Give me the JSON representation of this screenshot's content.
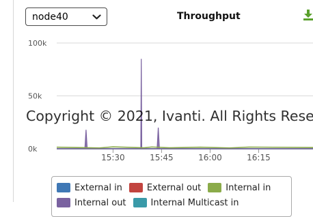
{
  "node_select": {
    "value": "node40"
  },
  "chart_title": "Throughput",
  "watermark": "Copyright © 2021, Ivanti. All Rights Rese",
  "chart_data": {
    "type": "line",
    "title": "Throughput",
    "xlabel": "",
    "ylabel": "",
    "ylim": [
      0,
      100000
    ],
    "y_ticks": [
      {
        "value": 0,
        "label": "0k"
      },
      {
        "value": 50000,
        "label": "50k"
      },
      {
        "value": 100000,
        "label": "100k"
      }
    ],
    "x_ticks": [
      {
        "value": 15.5,
        "label": "15:30"
      },
      {
        "value": 15.75,
        "label": "15:45"
      },
      {
        "value": 16.0,
        "label": "16:00"
      },
      {
        "value": 16.25,
        "label": "16:15"
      }
    ],
    "xlim": [
      15.21,
      16.53
    ],
    "grid": true,
    "legend_placement": "bottom",
    "series": [
      {
        "name": "External in",
        "color": "#3f78b5",
        "x": [
          15.21,
          16.53
        ],
        "values": [
          0,
          0
        ]
      },
      {
        "name": "External out",
        "color": "#c2443f",
        "x": [
          15.21,
          16.53
        ],
        "values": [
          0,
          0
        ]
      },
      {
        "name": "Internal in",
        "color": "#8bab4a",
        "x": [
          15.21,
          15.43,
          15.5,
          15.66,
          15.7,
          15.79,
          15.95,
          16.1,
          16.2,
          16.53
        ],
        "values": [
          1500,
          800,
          1800,
          900,
          1700,
          900,
          1500,
          800,
          1600,
          1200
        ]
      },
      {
        "name": "Internal out",
        "color": "#7a62a0",
        "x": [
          15.21,
          15.355,
          15.361,
          15.367,
          15.5,
          15.6,
          15.643,
          15.6455,
          15.648,
          15.66,
          15.727,
          15.733,
          15.739,
          15.9,
          16.1,
          16.53
        ],
        "values": [
          0,
          0,
          18000,
          0,
          0,
          0,
          0,
          85000,
          0,
          0,
          0,
          20000,
          0,
          0,
          0,
          0
        ]
      },
      {
        "name": "Internal Multicast in",
        "color": "#3a9aa8",
        "x": [
          15.21,
          16.53
        ],
        "values": [
          0,
          0
        ]
      }
    ]
  }
}
